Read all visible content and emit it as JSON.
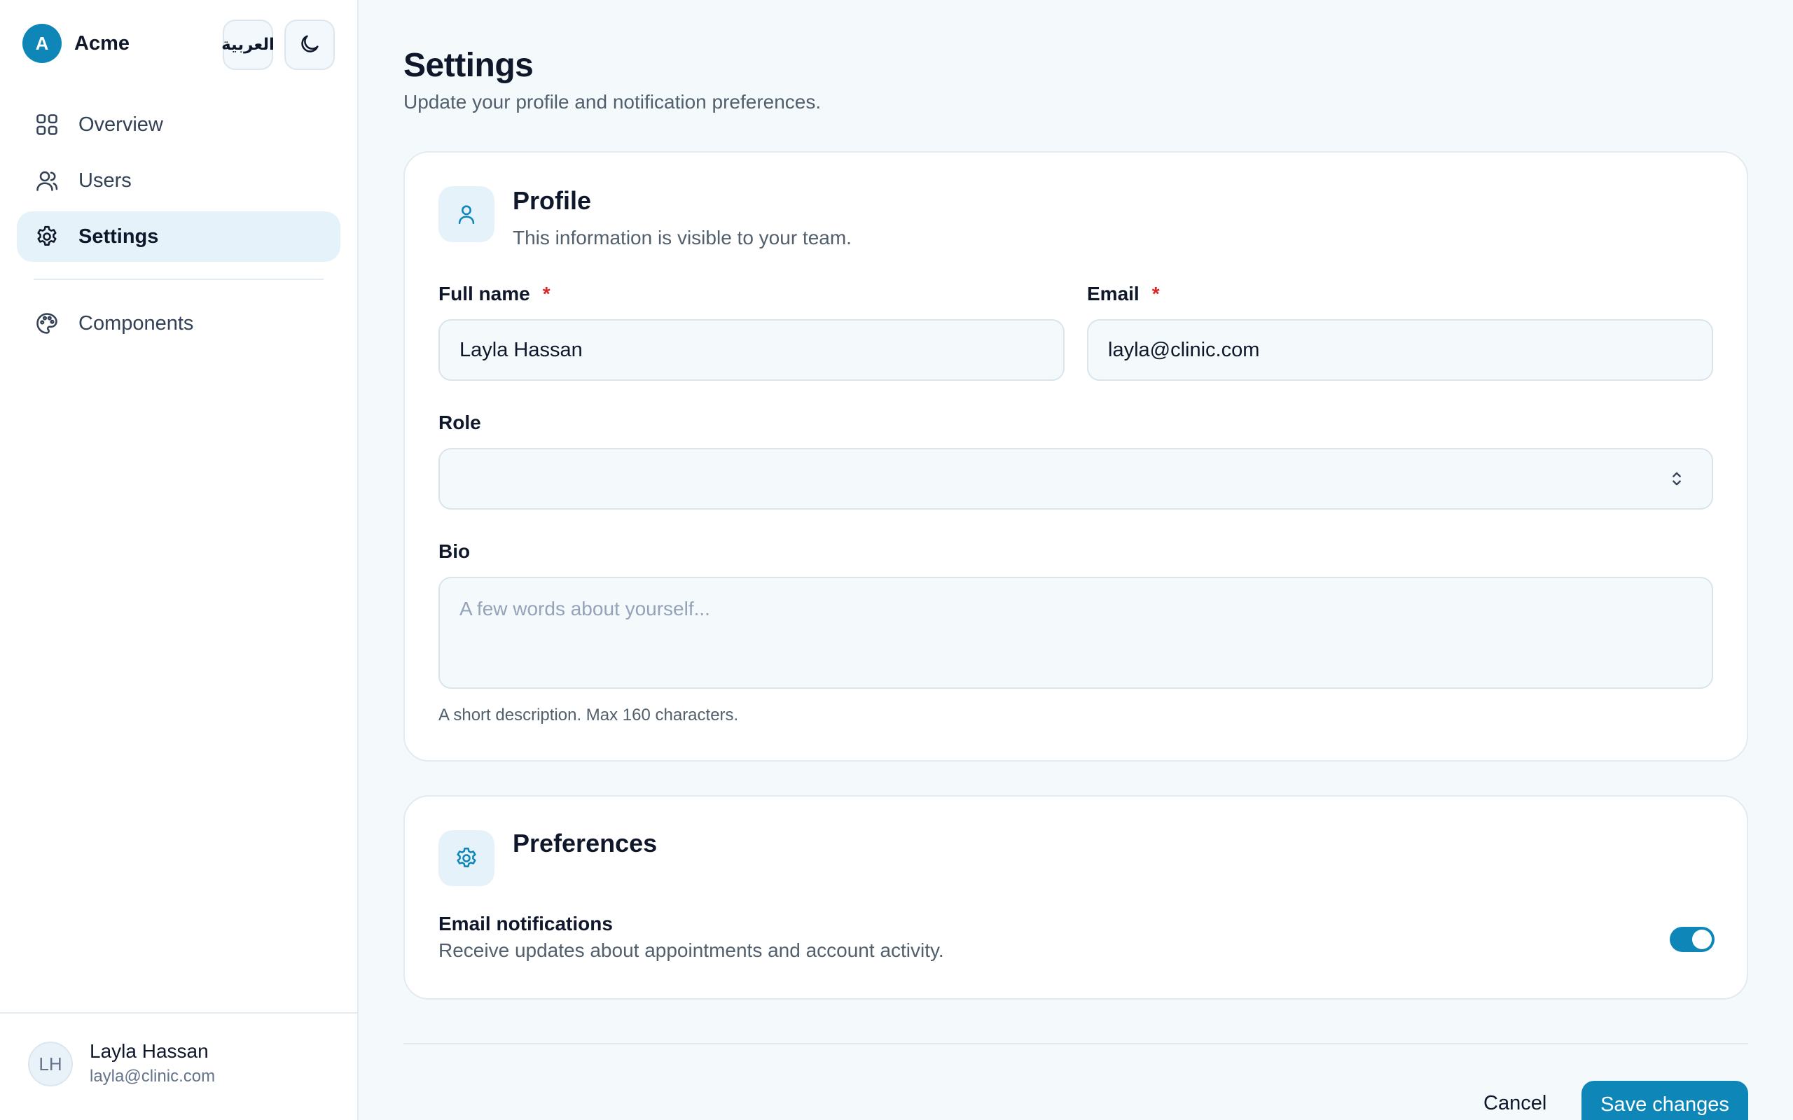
{
  "app": {
    "logo_letter": "A",
    "name": "Acme"
  },
  "header": {
    "language_label": "العربية",
    "theme_icon": "moon-icon"
  },
  "sidebar": {
    "items": [
      {
        "label": "Overview",
        "icon": "grid-icon"
      },
      {
        "label": "Users",
        "icon": "users-icon"
      },
      {
        "label": "Settings",
        "icon": "gear-icon",
        "active": true
      }
    ],
    "secondary_items": [
      {
        "label": "Components",
        "icon": "palette-icon"
      }
    ],
    "user": {
      "initials": "LH",
      "name": "Layla Hassan",
      "email": "layla@clinic.com"
    }
  },
  "page": {
    "title": "Settings",
    "subtitle": "Update your profile and notification preferences."
  },
  "profile": {
    "title": "Profile",
    "description": "This information is visible to your team.",
    "full_name": {
      "label": "Full name",
      "required_mark": "*",
      "value": "Layla Hassan"
    },
    "email": {
      "label": "Email",
      "required_mark": "*",
      "value": "layla@clinic.com"
    },
    "role": {
      "label": "Role",
      "value": ""
    },
    "bio": {
      "label": "Bio",
      "placeholder": "A few words about yourself...",
      "hint": "A short description. Max 160 characters."
    }
  },
  "preferences": {
    "title": "Preferences",
    "email_notifications": {
      "label": "Email notifications",
      "description": "Receive updates about appointments and account activity.",
      "enabled": true
    }
  },
  "actions": {
    "cancel_label": "Cancel",
    "save_label": "Save changes"
  },
  "colors": {
    "accent": "#0e87b8",
    "active_nav_bg": "#e6f2fa",
    "required": "#dc2626"
  }
}
